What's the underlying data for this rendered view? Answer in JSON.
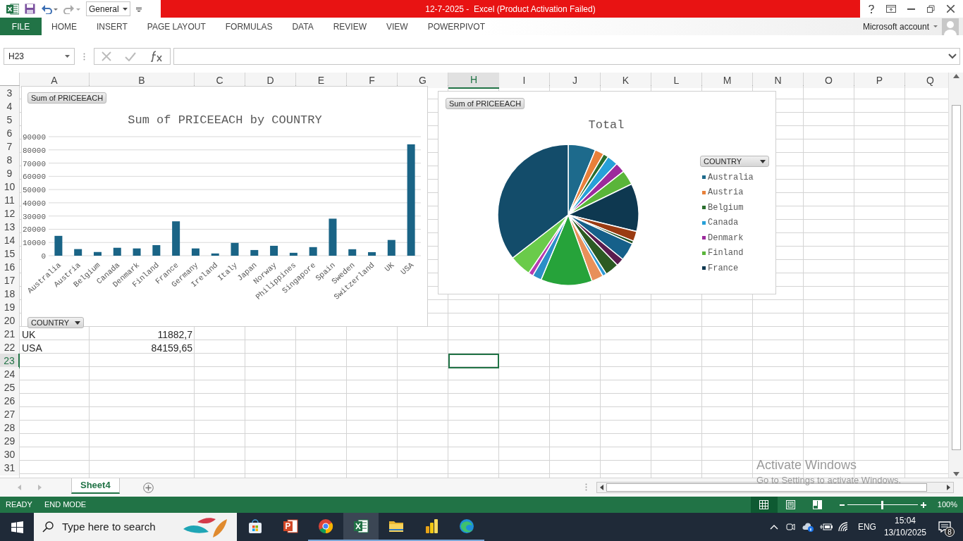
{
  "title_bar": {
    "number_format": "General",
    "title": "12-7-2025 -  Excel (Product Activation Failed)"
  },
  "ribbon": {
    "tabs": [
      {
        "label": "FILE",
        "kind": "file",
        "selected": false
      },
      {
        "label": "HOME",
        "kind": "tab",
        "selected": false
      },
      {
        "label": "INSERT",
        "kind": "tab",
        "selected": false
      },
      {
        "label": "PAGE LAYOUT",
        "kind": "tab",
        "selected": false
      },
      {
        "label": "FORMULAS",
        "kind": "tab",
        "selected": false
      },
      {
        "label": "DATA",
        "kind": "tab",
        "selected": false
      },
      {
        "label": "REVIEW",
        "kind": "tab",
        "selected": false
      },
      {
        "label": "VIEW",
        "kind": "tab",
        "selected": false
      },
      {
        "label": "POWERPIVOT",
        "kind": "tab",
        "selected": false
      }
    ],
    "account": "Microsoft account"
  },
  "formula_bar": {
    "name_box": "H23"
  },
  "sheet": {
    "columns": [
      {
        "label": "A",
        "selected": false
      },
      {
        "label": "B",
        "selected": false
      },
      {
        "label": "C",
        "selected": false
      },
      {
        "label": "D",
        "selected": false
      },
      {
        "label": "E",
        "selected": false
      },
      {
        "label": "F",
        "selected": false
      },
      {
        "label": "G",
        "selected": false
      },
      {
        "label": "H",
        "selected": true
      },
      {
        "label": "I",
        "selected": false
      },
      {
        "label": "J",
        "selected": false
      },
      {
        "label": "K",
        "selected": false
      },
      {
        "label": "L",
        "selected": false
      },
      {
        "label": "M",
        "selected": false
      },
      {
        "label": "N",
        "selected": false
      },
      {
        "label": "O",
        "selected": false
      },
      {
        "label": "P",
        "selected": false
      },
      {
        "label": "Q",
        "selected": false
      }
    ],
    "rows": [
      {
        "number": "3",
        "selected": false
      },
      {
        "number": "4",
        "selected": false
      },
      {
        "number": "5",
        "selected": false
      },
      {
        "number": "6",
        "selected": false
      },
      {
        "number": "7",
        "selected": false
      },
      {
        "number": "8",
        "selected": false
      },
      {
        "number": "9",
        "selected": false
      },
      {
        "number": "10",
        "selected": false
      },
      {
        "number": "11",
        "selected": false
      },
      {
        "number": "12",
        "selected": false
      },
      {
        "number": "13",
        "selected": false
      },
      {
        "number": "14",
        "selected": false
      },
      {
        "number": "15",
        "selected": false
      },
      {
        "number": "16",
        "selected": false
      },
      {
        "number": "17",
        "selected": false
      },
      {
        "number": "18",
        "selected": false
      },
      {
        "number": "19",
        "selected": false
      },
      {
        "number": "20",
        "selected": false
      },
      {
        "number": "21",
        "selected": false,
        "cells": [
          "UK",
          "11882,7"
        ]
      },
      {
        "number": "22",
        "selected": false,
        "cells": [
          "USA",
          "84159,65"
        ]
      },
      {
        "number": "23",
        "selected": true
      },
      {
        "number": "24",
        "selected": false
      },
      {
        "number": "25",
        "selected": false
      },
      {
        "number": "26",
        "selected": false
      },
      {
        "number": "27",
        "selected": false
      },
      {
        "number": "28",
        "selected": false
      },
      {
        "number": "29",
        "selected": false
      },
      {
        "number": "30",
        "selected": false
      },
      {
        "number": "31",
        "selected": false
      }
    ]
  },
  "charts": [
    {
      "field_button": "Sum of PRICEEACH",
      "axis_button": "COUNTRY",
      "chart_data": {
        "type": "bar",
        "title": "Sum of PRICEEACH by COUNTRY",
        "categories": [
          "Australia",
          "Austria",
          "Belgium",
          "Canada",
          "Denmark",
          "Finland",
          "France",
          "Germany",
          "Ireland",
          "Italy",
          "Japan",
          "Norway",
          "Philippines",
          "Singapore",
          "Spain",
          "Sweden",
          "Switzerland",
          "UK",
          "USA"
        ],
        "series": [
          {
            "color": "#1a6486",
            "values": [
              15000,
              5000,
              2800,
              6000,
              5500,
              8000,
              26000,
              5500,
              1700,
              9700,
              4300,
              7500,
              2200,
              6500,
              28000,
              4900,
              2700,
              11900,
              84200
            ]
          }
        ],
        "grid": true,
        "ylim": [
          0,
          90000
        ],
        "yticks": [
          0,
          10000,
          20000,
          30000,
          40000,
          50000,
          60000,
          70000,
          80000,
          90000
        ]
      }
    },
    {
      "field_button": "Sum of PRICEEACH",
      "legend": {
        "button": "COUNTRY",
        "items": [
          {
            "label": "Australia",
            "color": "#1d6a8c"
          },
          {
            "label": "Austria",
            "color": "#e8803a"
          },
          {
            "label": "Belgium",
            "color": "#2a6e2e"
          },
          {
            "label": "Canada",
            "color": "#27a0d8"
          },
          {
            "label": "Denmark",
            "color": "#9c2a9c"
          },
          {
            "label": "Finland",
            "color": "#5ab53a"
          },
          {
            "label": "France",
            "color": "#0e3850"
          }
        ]
      },
      "chart_data": {
        "type": "pie",
        "title": "Total",
        "series": [
          {
            "values": [
              6.3,
              2.1,
              1.2,
              2.5,
              2.3,
              3.4,
              11.0,
              2.3,
              0.7,
              4.1,
              1.8,
              3.2,
              0.9,
              2.7,
              11.8,
              2.1,
              1.1,
              5.0,
              35.5
            ]
          }
        ],
        "colors": [
          "#1d6a8c",
          "#e8803a",
          "#2a6e2e",
          "#27a0d8",
          "#9c2a9c",
          "#5ab53a",
          "#0e3850",
          "#9a3b12",
          "#1f4f1f",
          "#16608a",
          "#5a1c4e",
          "#2c5a23",
          "#2f9ad6",
          "#e8905a",
          "#26a33a",
          "#2b8fc7",
          "#b63bb0",
          "#6acb4a",
          "#134c6a"
        ]
      }
    }
  ],
  "sheet_tabs": [
    {
      "label": "Sheet4",
      "selected": true
    }
  ],
  "status_bar": {
    "mode": "READY",
    "end_mode": "END MODE",
    "views": [
      {
        "kind": "normal",
        "selected": true
      },
      {
        "kind": "page_layout",
        "selected": false
      },
      {
        "kind": "page_break",
        "selected": false
      }
    ],
    "zoom": {
      "level": 0.5,
      "label": "100%"
    }
  },
  "activation": {
    "title": "Activate Windows",
    "message": "Go to Settings to activate Windows."
  },
  "taskbar": {
    "search_placeholder": "Type here to search",
    "apps": [
      {
        "kind": "store",
        "open": false,
        "active": false
      },
      {
        "kind": "powerpoint",
        "open": false,
        "active": false
      },
      {
        "kind": "chrome",
        "open": true,
        "active": false
      },
      {
        "kind": "excel",
        "open": true,
        "active": true
      },
      {
        "kind": "explorer",
        "open": true,
        "active": false
      },
      {
        "kind": "powerbi",
        "open": true,
        "active": false
      },
      {
        "kind": "edge",
        "open": true,
        "active": false
      }
    ],
    "language": "ENG",
    "time": "15:04",
    "date": "13/10/2025",
    "notifications": "8"
  }
}
